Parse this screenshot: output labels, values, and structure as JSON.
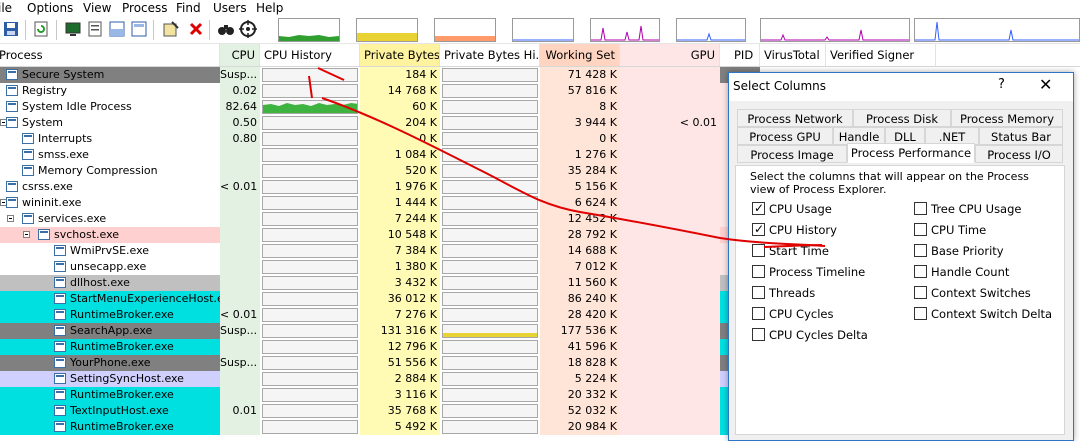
{
  "menu": [
    "ile",
    "Options",
    "View",
    "Process",
    "Find",
    "Users",
    "Help"
  ],
  "columns": {
    "process": "Process",
    "cpu": "CPU",
    "cpu_history": "CPU History",
    "private_bytes": "Private Bytes",
    "private_bytes_history": "Private Bytes Hi...",
    "working_set": "Working Set",
    "gpu": "GPU",
    "pid": "PID",
    "virustotal": "VirusTotal",
    "verified_signer": "Verified Signer"
  },
  "processes": [
    {
      "name": "Secure System",
      "cpu": "Susp...",
      "private": "184 K",
      "working": "71 428 K",
      "gpu": "",
      "indent": 0,
      "expander": false,
      "bg": "#808080"
    },
    {
      "name": "Registry",
      "cpu": "0.02",
      "private": "14 768 K",
      "working": "57 816 K",
      "gpu": "",
      "indent": 0,
      "expander": false,
      "bg": ""
    },
    {
      "name": "System Idle Process",
      "cpu": "82.64",
      "private": "60 K",
      "working": "8 K",
      "gpu": "",
      "indent": 0,
      "expander": false,
      "bg": ""
    },
    {
      "name": "System",
      "cpu": "0.50",
      "private": "204 K",
      "working": "3 944 K",
      "gpu": "< 0.01",
      "indent": 0,
      "expander": true,
      "bg": ""
    },
    {
      "name": "Interrupts",
      "cpu": "0.80",
      "private": "0 K",
      "working": "0 K",
      "gpu": "",
      "indent": 1,
      "expander": false,
      "bg": ""
    },
    {
      "name": "smss.exe",
      "cpu": "",
      "private": "1 084 K",
      "working": "1 276 K",
      "gpu": "",
      "indent": 1,
      "expander": false,
      "bg": ""
    },
    {
      "name": "Memory Compression",
      "cpu": "",
      "private": "520 K",
      "working": "35 284 K",
      "gpu": "",
      "indent": 1,
      "expander": false,
      "bg": ""
    },
    {
      "name": "csrss.exe",
      "cpu": "< 0.01",
      "private": "1 976 K",
      "working": "5 156 K",
      "gpu": "",
      "indent": 0,
      "expander": false,
      "bg": ""
    },
    {
      "name": "wininit.exe",
      "cpu": "",
      "private": "1 444 K",
      "working": "6 624 K",
      "gpu": "",
      "indent": 0,
      "expander": true,
      "bg": ""
    },
    {
      "name": "services.exe",
      "cpu": "",
      "private": "7 244 K",
      "working": "12 452 K",
      "gpu": "",
      "indent": 1,
      "expander": true,
      "bg": ""
    },
    {
      "name": "svchost.exe",
      "cpu": "",
      "private": "10 548 K",
      "working": "28 792 K",
      "gpu": "",
      "indent": 2,
      "expander": true,
      "bg": "#ffd0d0"
    },
    {
      "name": "WmiPrvSE.exe",
      "cpu": "",
      "private": "7 384 K",
      "working": "14 688 K",
      "gpu": "",
      "indent": 3,
      "expander": false,
      "bg": ""
    },
    {
      "name": "unsecapp.exe",
      "cpu": "",
      "private": "1 380 K",
      "working": "7 012 K",
      "gpu": "",
      "indent": 3,
      "expander": false,
      "bg": ""
    },
    {
      "name": "dllhost.exe",
      "cpu": "",
      "private": "3 432 K",
      "working": "11 560 K",
      "gpu": "",
      "indent": 3,
      "expander": false,
      "bg": "#c0c0c0"
    },
    {
      "name": "StartMenuExperienceHost.exe",
      "cpu": "",
      "private": "36 012 K",
      "working": "86 240 K",
      "gpu": "",
      "indent": 3,
      "expander": false,
      "bg": "#00e0e0"
    },
    {
      "name": "RuntimeBroker.exe",
      "cpu": "< 0.01",
      "private": "7 276 K",
      "working": "28 420 K",
      "gpu": "",
      "indent": 3,
      "expander": false,
      "bg": "#00e0e0"
    },
    {
      "name": "SearchApp.exe",
      "cpu": "Susp...",
      "private": "131 316 K",
      "working": "177 536 K",
      "gpu": "",
      "indent": 3,
      "expander": false,
      "bg": "#808080"
    },
    {
      "name": "RuntimeBroker.exe",
      "cpu": "",
      "private": "12 796 K",
      "working": "41 596 K",
      "gpu": "",
      "indent": 3,
      "expander": false,
      "bg": "#00e0e0"
    },
    {
      "name": "YourPhone.exe",
      "cpu": "Susp...",
      "private": "51 556 K",
      "working": "18 828 K",
      "gpu": "",
      "indent": 3,
      "expander": false,
      "bg": "#808080"
    },
    {
      "name": "SettingSyncHost.exe",
      "cpu": "",
      "private": "2 884 K",
      "working": "5 224 K",
      "gpu": "",
      "indent": 3,
      "expander": false,
      "bg": "#d0d0ff"
    },
    {
      "name": "RuntimeBroker.exe",
      "cpu": "",
      "private": "3 116 K",
      "working": "20 332 K",
      "gpu": "",
      "indent": 3,
      "expander": false,
      "bg": "#00e0e0"
    },
    {
      "name": "TextInputHost.exe",
      "cpu": "0.01",
      "private": "35 768 K",
      "working": "52 032 K",
      "gpu": "",
      "indent": 3,
      "expander": false,
      "bg": "#00e0e0"
    },
    {
      "name": "RuntimeBroker.exe",
      "cpu": "",
      "private": "5 492 K",
      "working": "20 984 K",
      "gpu": "",
      "indent": 3,
      "expander": false,
      "bg": "#00e0e0"
    }
  ],
  "dialog": {
    "title": "Select Columns",
    "help_label": "?",
    "close_label": "✕",
    "tabs_row1": [
      "Process Network",
      "Process Disk",
      "Process Memory"
    ],
    "tabs_row2": [
      "Process GPU",
      "Handle",
      "DLL",
      ".NET",
      "Status Bar"
    ],
    "tabs_row3": [
      "Process Image",
      "Process Performance",
      "Process I/O"
    ],
    "active_tab": "Process Performance",
    "description": "Select the columns that will appear on the Process view of Process Explorer.",
    "options_left": [
      {
        "label": "CPU Usage",
        "checked": true
      },
      {
        "label": "CPU History",
        "checked": true
      },
      {
        "label": "Start Time",
        "checked": false
      },
      {
        "label": "Process Timeline",
        "checked": false
      },
      {
        "label": "Threads",
        "checked": false
      },
      {
        "label": "CPU Cycles",
        "checked": false
      },
      {
        "label": "CPU Cycles Delta",
        "checked": false
      }
    ],
    "options_right": [
      {
        "label": "Tree CPU Usage",
        "checked": false
      },
      {
        "label": "CPU Time",
        "checked": false
      },
      {
        "label": "Base Priority",
        "checked": false
      },
      {
        "label": "Handle Count",
        "checked": false
      },
      {
        "label": "Context Switches",
        "checked": false
      },
      {
        "label": "Context Switch Delta",
        "checked": false
      }
    ]
  },
  "colors": {
    "cpu_column": "#e2f1e2",
    "private_column": "#fffab4",
    "working_column": "#ffe4d8",
    "gpu_column": "#ffe6e6",
    "annotation": "#e00000",
    "dialog_border": "#2b77c5"
  }
}
